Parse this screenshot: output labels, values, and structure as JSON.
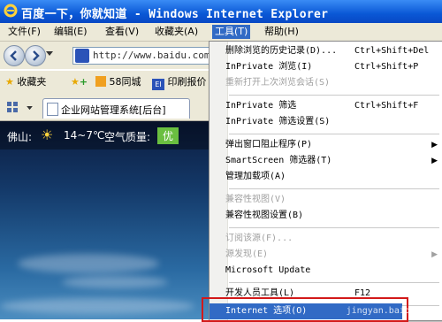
{
  "window": {
    "title": "百度一下，你就知道 - Windows Internet Explorer"
  },
  "menubar": {
    "items": [
      {
        "label": "文件(F)"
      },
      {
        "label": "编辑(E)"
      },
      {
        "label": "查看(V)"
      },
      {
        "label": "收藏夹(A)"
      },
      {
        "label": "工具(T)"
      },
      {
        "label": "帮助(H)"
      }
    ],
    "active": "工具(T)"
  },
  "address_bar": {
    "url": "http://www.baidu.com/"
  },
  "favorites_bar": {
    "items": [
      {
        "label": "收藏夹"
      },
      {
        "label": "58同城"
      },
      {
        "label": "印刷报价"
      }
    ]
  },
  "tab": {
    "label": "企业网站管理系统[后台]"
  },
  "weather": {
    "city": "佛山:",
    "temp": "14~7℃",
    "aq_label": "空气质量:",
    "aq_value": "优"
  },
  "tools_menu": {
    "items": [
      {
        "label": "删除浏览的历史记录(D)...",
        "shortcut": "Ctrl+Shift+Del"
      },
      {
        "label": "InPrivate 浏览(I)",
        "shortcut": "Ctrl+Shift+P"
      },
      {
        "label": "重新打开上次浏览会话(S)",
        "shortcut": "",
        "disabled": true
      },
      {
        "label": "InPrivate 筛选",
        "shortcut": "Ctrl+Shift+F"
      },
      {
        "label": "InPrivate 筛选设置(S)",
        "shortcut": ""
      },
      {
        "label": "弹出窗口阻止程序(P)",
        "shortcut": "",
        "submenu": true
      },
      {
        "label": "SmartScreen 筛选器(T)",
        "shortcut": "",
        "submenu": true
      },
      {
        "label": "管理加载项(A)",
        "shortcut": ""
      },
      {
        "label": "兼容性视图(V)",
        "shortcut": "",
        "disabled": true
      },
      {
        "label": "兼容性视图设置(B)",
        "shortcut": ""
      },
      {
        "label": "订阅该源(F)...",
        "shortcut": "",
        "disabled": true
      },
      {
        "label": "源发现(E)",
        "shortcut": "",
        "disabled": true,
        "submenu": true
      },
      {
        "label": "Microsoft Update",
        "shortcut": ""
      },
      {
        "label": "开发人员工具(L)",
        "shortcut": "F12"
      },
      {
        "label": "Internet 选项(O)",
        "shortcut": "",
        "highlight": true
      }
    ]
  },
  "watermark": "jingyan.baidu.com",
  "colors": {
    "titlebar": "#0a58d6",
    "menu_highlight": "#316ac5",
    "red_box": "#d21919",
    "aq_badge": "#6abf40"
  }
}
